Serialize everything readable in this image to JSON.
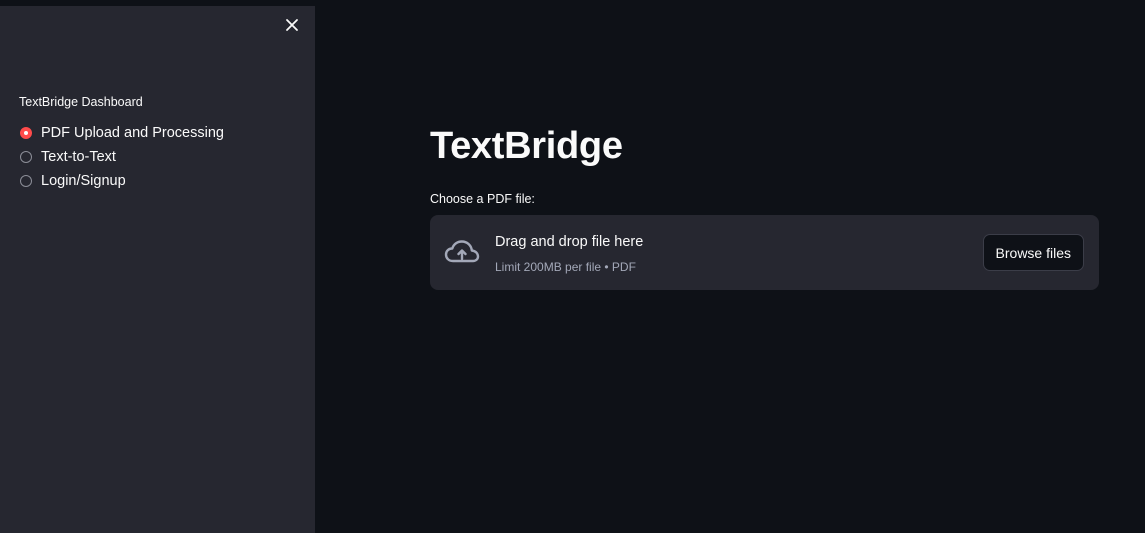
{
  "sidebar": {
    "radio_group_label": "TextBridge Dashboard",
    "options": [
      {
        "label": "PDF Upload and Processing",
        "selected": true
      },
      {
        "label": "Text-to-Text",
        "selected": false
      },
      {
        "label": "Login/Signup",
        "selected": false
      }
    ],
    "close_icon": "close-icon"
  },
  "main": {
    "title": "TextBridge",
    "uploader": {
      "label": "Choose a PDF file:",
      "drop_text": "Drag and drop file here",
      "limit_text": "Limit 200MB per file • PDF",
      "browse_label": "Browse files",
      "icon": "cloud-upload-icon"
    }
  },
  "colors": {
    "background": "#0e1117",
    "sidebar": "#262730",
    "accent": "#ff4b4b",
    "text": "#fafafa",
    "muted_text": "#a3a8b8"
  }
}
